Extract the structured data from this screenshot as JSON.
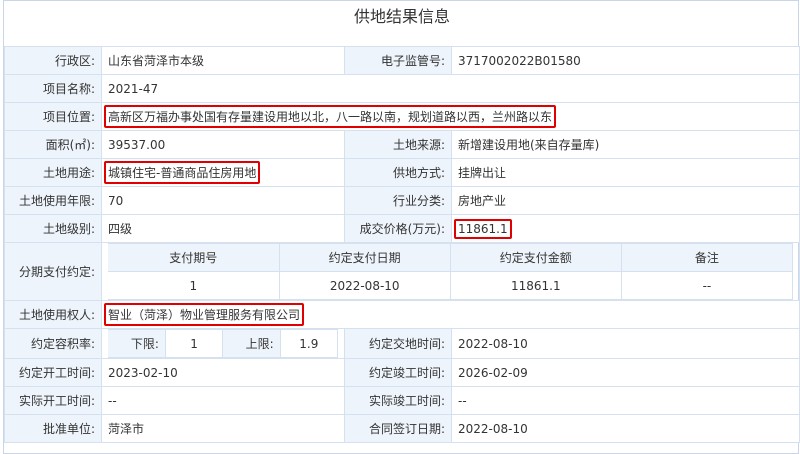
{
  "title": "供地结果信息",
  "rows": {
    "district": {
      "label": "行政区:",
      "value": "山东省菏泽市本级"
    },
    "supervision_no": {
      "label": "电子监管号:",
      "value": "3717002022B01580"
    },
    "project_name": {
      "label": "项目名称:",
      "value": "2021-47"
    },
    "project_location": {
      "label": "项目位置:",
      "value": "高新区万福办事处国有存量建设用地以北，八一路以南，规划道路以西，兰州路以东"
    },
    "area": {
      "label": "面积(㎡):",
      "value": "39537.00"
    },
    "land_source": {
      "label": "土地来源:",
      "value": "新增建设用地(来自存量库)"
    },
    "land_use": {
      "label": "土地用途:",
      "value": "城镇住宅-普通商品住房用地"
    },
    "supply_method": {
      "label": "供地方式:",
      "value": "挂牌出让"
    },
    "use_years": {
      "label": "土地使用年限:",
      "value": "70"
    },
    "industry": {
      "label": "行业分类:",
      "value": "房地产业"
    },
    "land_level": {
      "label": "土地级别:",
      "value": "四级"
    },
    "price": {
      "label": "成交价格(万元):",
      "value": "11861.1"
    },
    "installments": {
      "label": "分期支付约定:",
      "headers": [
        "支付期号",
        "约定支付日期",
        "约定支付金额",
        "备注"
      ],
      "rows": [
        [
          "1",
          "2022-08-10",
          "11861.1",
          "--"
        ]
      ]
    },
    "land_user": {
      "label": "土地使用权人:",
      "value": "智业（菏泽）物业管理服务有限公司"
    },
    "plot_ratio": {
      "label": "约定容积率:",
      "lower_label": "下限:",
      "lower": "1",
      "upper_label": "上限:",
      "upper": "1.9"
    },
    "delivery_time": {
      "label": "约定交地时间:",
      "value": "2022-08-10"
    },
    "start_time": {
      "label": "约定开工时间:",
      "value": "2023-02-10"
    },
    "completion_time": {
      "label": "约定竣工时间:",
      "value": "2026-02-09"
    },
    "actual_start": {
      "label": "实际开工时间:",
      "value": "--"
    },
    "actual_completion": {
      "label": "实际竣工时间:",
      "value": "--"
    },
    "approval_unit": {
      "label": "批准单位:",
      "value": "菏泽市"
    },
    "contract_date": {
      "label": "合同签订日期:",
      "value": "2022-08-10"
    }
  },
  "colors": {
    "label_bg": "#eef4fb",
    "border": "#d6e1ef",
    "highlight": "#e00000"
  }
}
